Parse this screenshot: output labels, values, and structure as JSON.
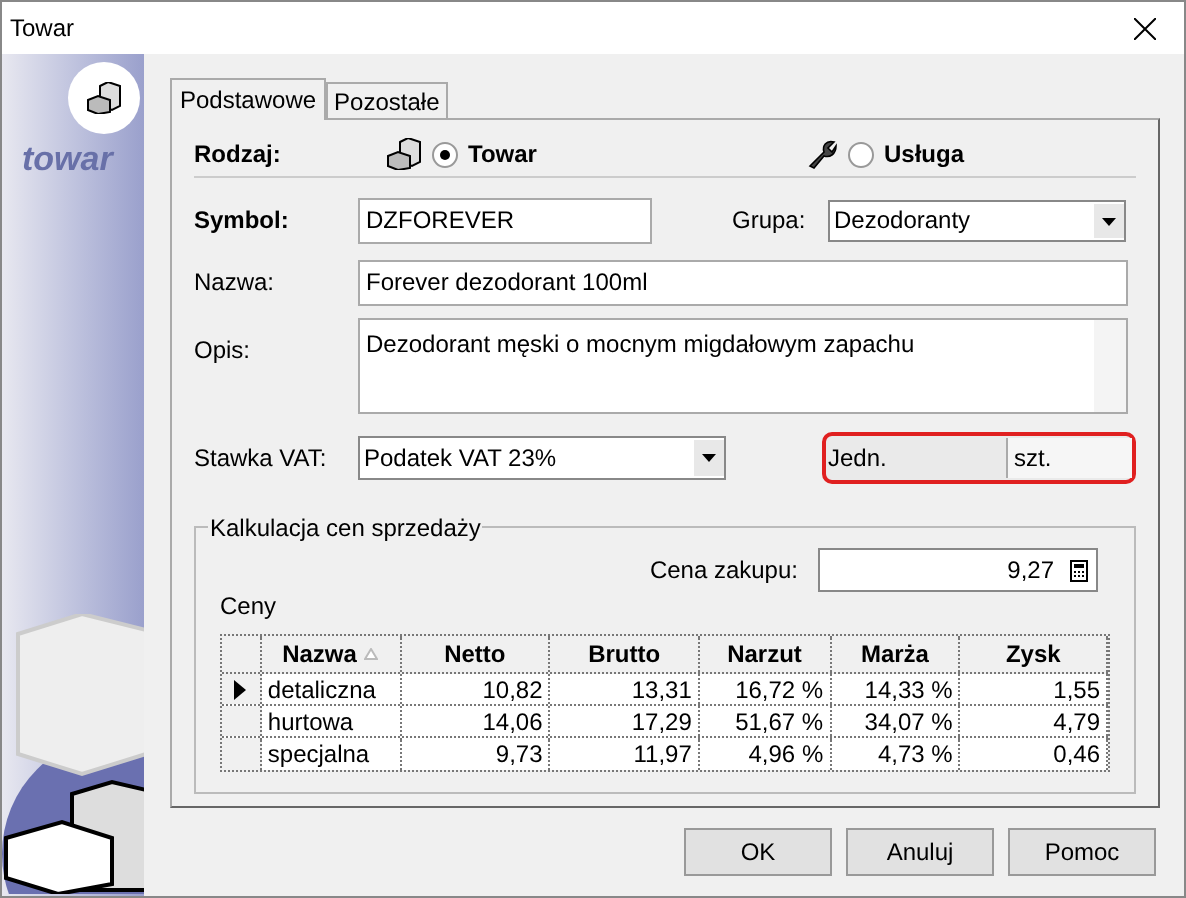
{
  "window": {
    "title": "Towar",
    "logo_text": "towar"
  },
  "tabs": [
    {
      "label": "Podstawowe",
      "selected": true
    },
    {
      "label": "Pozostałe",
      "selected": false
    }
  ],
  "rodzaj": {
    "label": "Rodzaj:",
    "options": [
      {
        "label": "Towar",
        "kind": "product",
        "selected": true
      },
      {
        "label": "Usługa",
        "kind": "service",
        "selected": false
      }
    ]
  },
  "symbol": {
    "label": "Symbol:",
    "value": "DZFOREVER"
  },
  "grupa": {
    "label": "Grupa:",
    "value": "Dezodoranty"
  },
  "nazwa": {
    "label": "Nazwa:",
    "value": "Forever dezodorant 100ml"
  },
  "opis": {
    "label": "Opis:",
    "value": "Dezodorant męski o mocnym migdałowym zapachu"
  },
  "vat": {
    "label": "Stawka VAT:",
    "value": "Podatek VAT 23%"
  },
  "jedn": {
    "label": "Jedn.",
    "value": "szt.",
    "highlighted": true
  },
  "kalkulacja": {
    "title": "Kalkulacja cen sprzedaży",
    "cena_zakupu": {
      "label": "Cena zakupu:",
      "value": "9,27"
    },
    "ceny_label": "Ceny",
    "columns": [
      "Nazwa",
      "Netto",
      "Brutto",
      "Narzut",
      "Marża",
      "Zysk"
    ],
    "rows": [
      {
        "selected": true,
        "cells": [
          "detaliczna",
          "10,82",
          "13,31",
          "16,72 %",
          "14,33 %",
          "1,55"
        ]
      },
      {
        "selected": false,
        "cells": [
          "hurtowa",
          "14,06",
          "17,29",
          "51,67 %",
          "34,07 %",
          "4,79"
        ]
      },
      {
        "selected": false,
        "cells": [
          "specjalna",
          "9,73",
          "11,97",
          "4,96 %",
          "4,73 %",
          "0,46"
        ]
      }
    ]
  },
  "buttons": [
    "OK",
    "Anuluj",
    "Pomoc"
  ]
}
